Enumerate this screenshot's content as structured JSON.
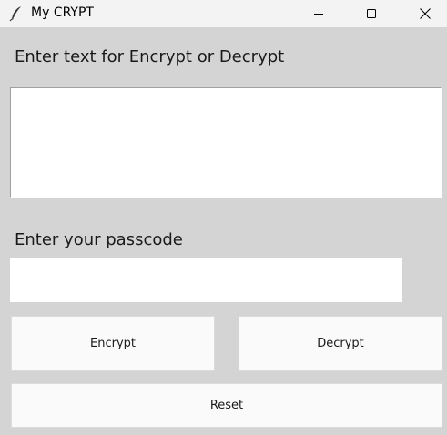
{
  "window": {
    "title": "My CRYPT",
    "app_icon": "feather-icon",
    "controls": [
      "minimize-icon",
      "maximize-icon",
      "close-icon"
    ]
  },
  "form": {
    "text_label": "Enter text for Encrypt or Decrypt",
    "text_value": "",
    "passcode_label": "Enter your passcode",
    "passcode_value": ""
  },
  "buttons": {
    "encrypt": "Encrypt",
    "decrypt": "Decrypt",
    "reset": "Reset"
  },
  "colors": {
    "background": "#d4d4d4",
    "titlebar": "#f3f3f3",
    "field": "#ffffff",
    "button": "#fafafa"
  }
}
